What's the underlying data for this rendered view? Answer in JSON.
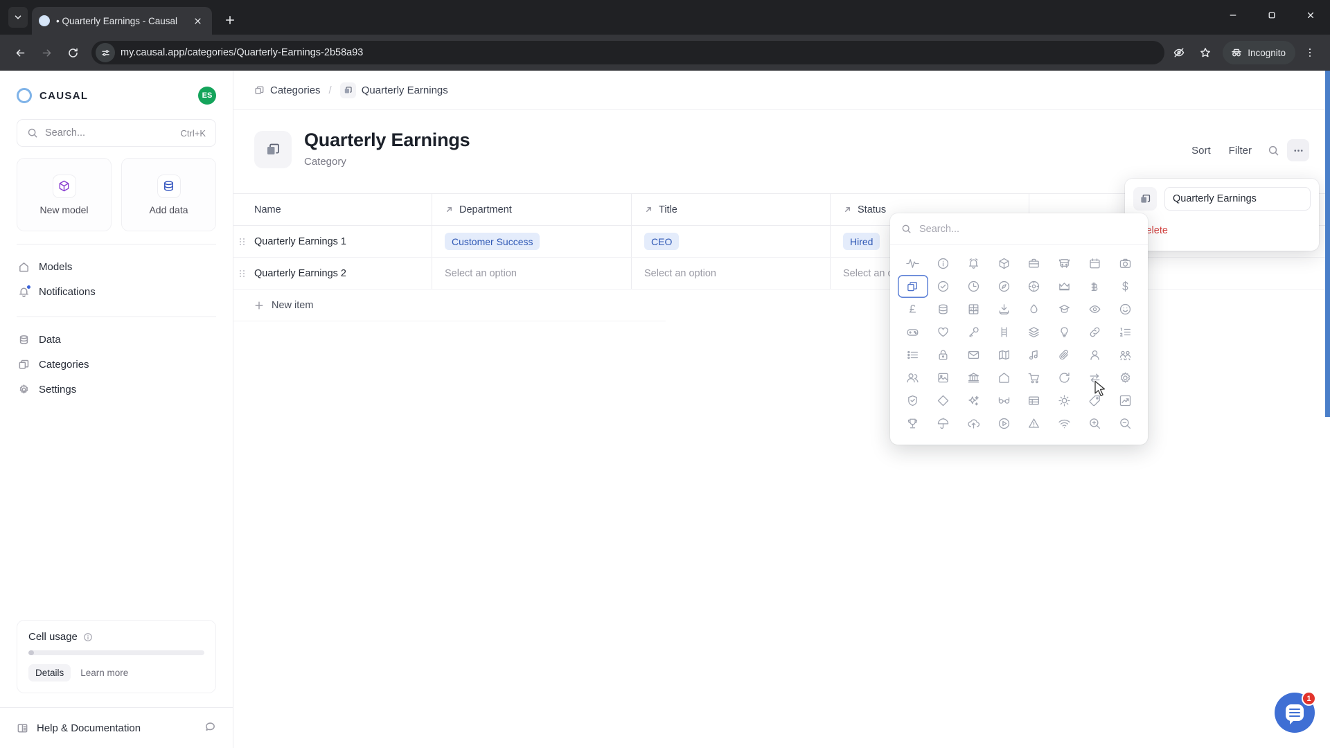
{
  "browser": {
    "tab": {
      "title": "• Quarterly Earnings - Causal",
      "favicon": "causal-logo-icon"
    },
    "new_tab_label": "+",
    "url": "my.causal.app/categories/Quarterly-Earnings-2b58a93",
    "profile_label": "Incognito",
    "icons": {
      "tab_search": "chevron-down-icon",
      "back": "back-arrow-icon",
      "forward": "forward-arrow-icon",
      "reload": "reload-icon",
      "site_info": "site-settings-icon",
      "translate": "eye-off-icon",
      "bookmark": "star-icon",
      "menu": "kebab-menu-icon",
      "minimize": "minimize-icon",
      "maximize": "maximize-icon",
      "close": "window-close-icon"
    }
  },
  "sidebar": {
    "brand": "CAUSAL",
    "avatar_initials": "ES",
    "search": {
      "placeholder": "Search...",
      "shortcut": "Ctrl+K"
    },
    "cards": [
      {
        "label": "New model",
        "icon": "cube-icon"
      },
      {
        "label": "Add data",
        "icon": "database-icon"
      }
    ],
    "nav_primary": [
      {
        "label": "Models",
        "icon": "home-icon",
        "badge": false
      },
      {
        "label": "Notifications",
        "icon": "bell-icon",
        "badge": true
      }
    ],
    "nav_secondary": [
      {
        "label": "Data",
        "icon": "database-icon"
      },
      {
        "label": "Categories",
        "icon": "categories-icon"
      },
      {
        "label": "Settings",
        "icon": "gear-icon"
      }
    ],
    "usage": {
      "title": "Cell usage",
      "info_icon": "info-icon",
      "progress_percent": 3,
      "details_label": "Details",
      "learn_more_label": "Learn more"
    },
    "help": {
      "label": "Help & Documentation",
      "icon": "book-icon",
      "chat_icon": "chat-icon"
    }
  },
  "breadcrumb": {
    "root": {
      "label": "Categories",
      "icon": "categories-icon"
    },
    "separator": "/",
    "current": {
      "label": "Quarterly Earnings",
      "icon": "categories-icon"
    }
  },
  "page": {
    "title": "Quarterly Earnings",
    "subtitle": "Category",
    "icon": "categories-icon",
    "actions": {
      "sort": "Sort",
      "filter": "Filter",
      "search_icon": "search-icon",
      "more_icon": "more-horizontal-icon"
    }
  },
  "table": {
    "columns": [
      {
        "label": "Name",
        "has_arrow": false
      },
      {
        "label": "Department",
        "has_arrow": true
      },
      {
        "label": "Title",
        "has_arrow": true
      },
      {
        "label": "Status",
        "has_arrow": true
      }
    ],
    "rows": [
      {
        "name": "Quarterly Earnings 1",
        "department": {
          "value": "Customer Success",
          "type": "pill"
        },
        "title": {
          "value": "CEO",
          "type": "pill"
        },
        "status": {
          "value": "Hired",
          "type": "pill"
        }
      },
      {
        "name": "Quarterly Earnings 2",
        "department": {
          "value": "Select an option",
          "type": "placeholder"
        },
        "title": {
          "value": "Select an option",
          "type": "placeholder"
        },
        "status": {
          "value": "Select an option",
          "type": "placeholder"
        }
      }
    ],
    "new_item_label": "New item"
  },
  "rename_popover": {
    "icon": "categories-icon",
    "name_value": "Quarterly Earnings",
    "delete_label": "Delete"
  },
  "icon_picker": {
    "search_placeholder": "Search...",
    "selected_index": 8,
    "icons": [
      "activity-icon",
      "info-icon",
      "alarm-icon",
      "cube-icon",
      "briefcase-icon",
      "bus-icon",
      "calendar-icon",
      "camera-icon",
      "categories-icon",
      "check-circle-icon",
      "clock-icon",
      "compass-icon",
      "crosshair-icon",
      "crown-icon",
      "bitcoin-icon",
      "dollar-icon",
      "pound-icon",
      "database-icon",
      "locker-icon",
      "download-icon",
      "droplet-icon",
      "graduation-cap-icon",
      "eye-icon",
      "smiley-icon",
      "gamepad-icon",
      "heart-icon",
      "key-icon",
      "ladder-icon",
      "layers-icon",
      "lightbulb-icon",
      "link-icon",
      "ordered-list-icon",
      "bullet-list-icon",
      "lock-icon",
      "mail-icon",
      "map-icon",
      "music-icon",
      "paperclip-icon",
      "person-icon",
      "people-group-icon",
      "users-icon",
      "image-icon",
      "bank-icon",
      "home-icon",
      "cart-icon",
      "refresh-icon",
      "transfer-icon",
      "gear-icon",
      "shield-check-icon",
      "diamond-icon",
      "sparkles-icon",
      "glasses-icon",
      "table-icon",
      "sun-icon",
      "tag-icon",
      "trend-up-icon",
      "trophy-icon",
      "umbrella-icon",
      "cloud-upload-icon",
      "play-circle-icon",
      "warning-icon",
      "wifi-icon",
      "zoom-in-icon",
      "zoom-out-icon"
    ]
  },
  "chat_widget": {
    "badge_count": "1",
    "icon": "chat-bubble-icon"
  },
  "colors": {
    "accent_blue": "#3f6fd4",
    "pill_bg": "#e4ecfb",
    "pill_text": "#2f58b5",
    "danger": "#d2413f",
    "avatar_green": "#14a45b",
    "badge_red": "#e2342c"
  }
}
